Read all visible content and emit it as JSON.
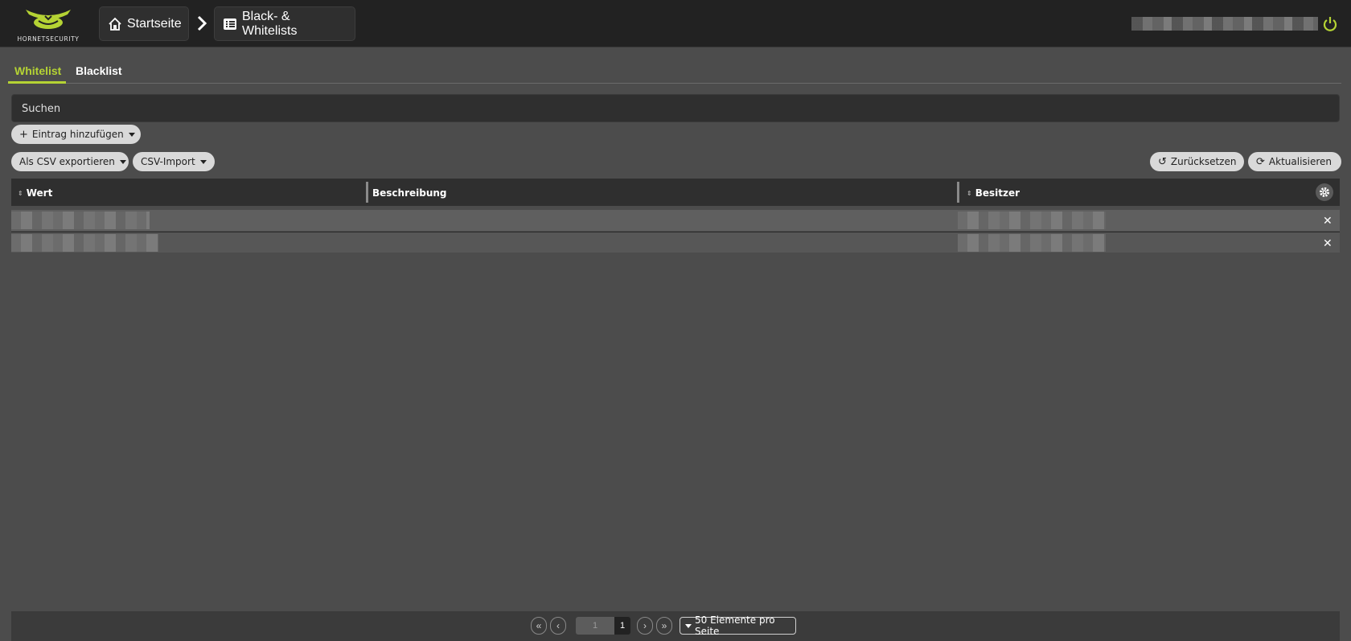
{
  "header": {
    "logo_text": "HORNETSECURITY",
    "breadcrumb": [
      {
        "label": "Startseite",
        "icon": "home-icon"
      },
      {
        "label": "Black- & Whitelists",
        "icon": "list-icon"
      }
    ],
    "accent_color": "#b5d334"
  },
  "tabs": [
    {
      "label": "Whitelist",
      "active": true
    },
    {
      "label": "Blacklist",
      "active": false
    }
  ],
  "search": {
    "placeholder": "Suchen"
  },
  "toolbar": {
    "add_label": "Eintrag hinzufügen",
    "csv_export_label": "Als CSV exportieren",
    "csv_import_label": "CSV-Import",
    "reset_label": "Zurücksetzen",
    "refresh_label": "Aktualisieren"
  },
  "table": {
    "columns": [
      "Wert",
      "Beschreibung",
      "Besitzer"
    ],
    "rows": [
      {
        "value": "",
        "description": "",
        "owner": ""
      },
      {
        "value": "",
        "description": "",
        "owner": ""
      }
    ]
  },
  "pager": {
    "current_page": "1",
    "total_pages": "1",
    "per_page_label": "50 Elemente pro Seite"
  }
}
